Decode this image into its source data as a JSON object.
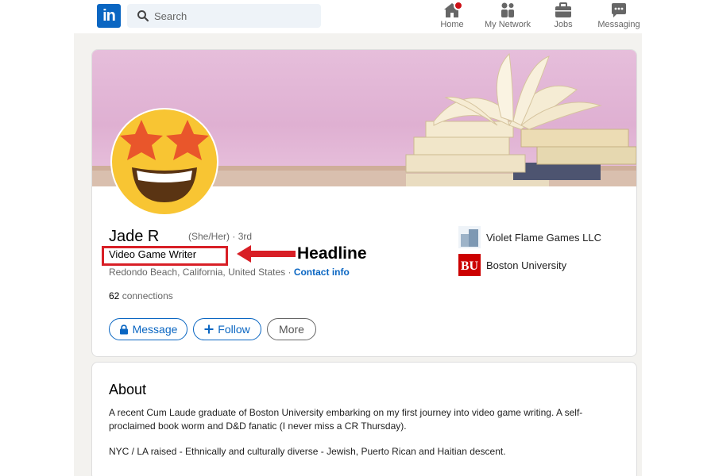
{
  "nav": {
    "logo": "in",
    "search_placeholder": "Search",
    "items": [
      {
        "label": "Home",
        "icon": "home-icon"
      },
      {
        "label": "My Network",
        "icon": "network-icon"
      },
      {
        "label": "Jobs",
        "icon": "briefcase-icon"
      },
      {
        "label": "Messaging",
        "icon": "messaging-icon"
      }
    ]
  },
  "profile": {
    "name": "Jade R",
    "pronouns": "(She/Her)",
    "degree": "· 3rd",
    "headline": "Video Game Writer",
    "location": "Redondo Beach, California, United States",
    "location_sep": " · ",
    "contact_info": "Contact info",
    "connections_count": "62",
    "connections_label": "connections",
    "buttons": {
      "message": "Message",
      "follow": "Follow",
      "more": "More"
    },
    "orgs": [
      {
        "name": "Violet Flame Games LLC",
        "icon": "company-logo"
      },
      {
        "name": "Boston University",
        "icon": "bu-logo",
        "logo_text": "BU"
      }
    ]
  },
  "annotation": {
    "label": "Headline"
  },
  "about": {
    "title": "About",
    "paragraph1": "A recent Cum Laude graduate of Boston University embarking on my first journey into video game writing. A self-proclaimed book worm and D&D fanatic (I never miss a CR Thursday).",
    "paragraph2": "NYC / LA raised - Ethnically and culturally diverse - Jewish, Puerto Rican and Haitian descent."
  },
  "colors": {
    "brand": "#0a66c2",
    "page_bg": "#f3f2ef",
    "annotation_red": "#d81f26",
    "badge_red": "#cc1016"
  }
}
